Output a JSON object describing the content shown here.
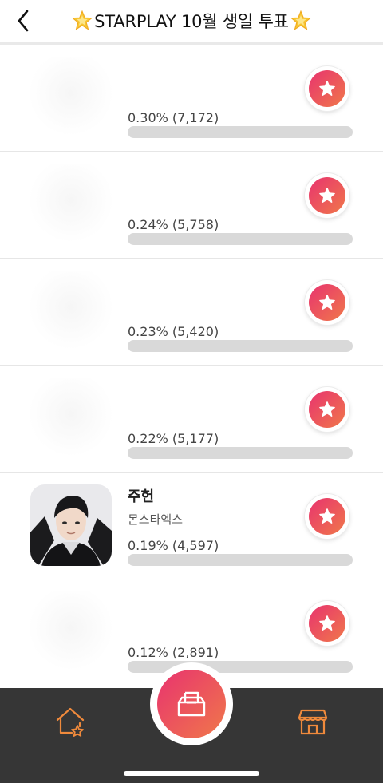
{
  "header": {
    "back_icon": "chevron-left-icon",
    "title_icon": "glowing-star-emoji",
    "title": "STARPLAY 10월 생일 투표"
  },
  "rows": [
    {
      "name": "",
      "group": "",
      "stat": "0.30% (7,172)",
      "percent": 0.3
    },
    {
      "name": "",
      "group": "",
      "stat": "0.24% (5,758)",
      "percent": 0.24
    },
    {
      "name": "",
      "group": "",
      "stat": "0.23% (5,420)",
      "percent": 0.23
    },
    {
      "name": "",
      "group": "",
      "stat": "0.22% (5,177)",
      "percent": 0.22
    },
    {
      "name": "주헌",
      "group": "몬스타엑스",
      "stat": "0.19% (4,597)",
      "percent": 0.19
    },
    {
      "name": "",
      "group": "",
      "stat": "0.12% (2,891)",
      "percent": 0.12
    }
  ],
  "colors": {
    "accent_start": "#e8336f",
    "accent_end": "#f0784a",
    "nav_icon": "#f08a3c",
    "bottom_bar": "#363636",
    "bar_track": "#d9d9d9"
  },
  "bottom_nav": {
    "home_icon": "home-star-icon",
    "center_icon": "ballot-box-icon",
    "shop_icon": "store-icon"
  }
}
